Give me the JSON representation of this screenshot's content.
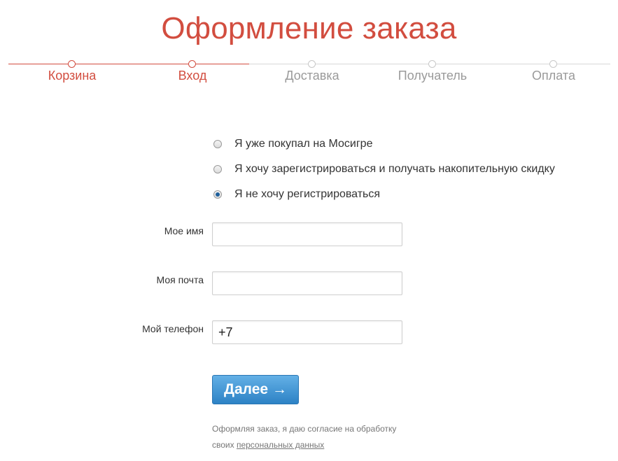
{
  "page": {
    "title": "Оформление заказа"
  },
  "stepper": {
    "steps": [
      {
        "label": "Корзина",
        "state": "done"
      },
      {
        "label": "Вход",
        "state": "current"
      },
      {
        "label": "Доставка",
        "state": "pending"
      },
      {
        "label": "Получатель",
        "state": "pending"
      },
      {
        "label": "Оплата",
        "state": "pending"
      }
    ]
  },
  "auth_options": {
    "options": [
      {
        "label": "Я уже покупал на Мосигре",
        "checked": false
      },
      {
        "label": "Я хочу зарегистрироваться и получать накопительную скидку",
        "checked": false
      },
      {
        "label": "Я не хочу регистрироваться",
        "checked": true
      }
    ]
  },
  "form": {
    "name": {
      "label": "Мое имя",
      "value": ""
    },
    "email": {
      "label": "Моя почта",
      "value": ""
    },
    "phone": {
      "label": "Мой телефон",
      "value": "+7"
    },
    "submit_label": "Далее →"
  },
  "consent": {
    "text_line1": "Оформляя заказ, я даю согласие на обработку",
    "text_line2_prefix": "своих ",
    "link_text": "персональных данных"
  },
  "colors": {
    "accent": "#d24d3f",
    "button": "#2d82c5",
    "inactive": "#9a9a9a"
  }
}
